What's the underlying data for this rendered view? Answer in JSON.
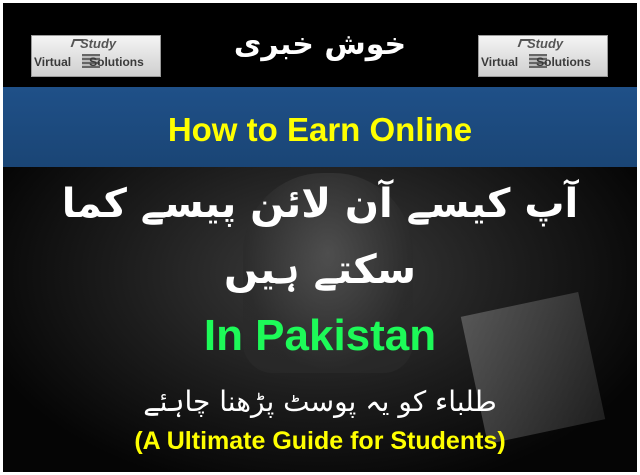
{
  "header": {
    "title_urdu": "خوش خبری",
    "logo_left": {
      "top": "Study",
      "left": "Virtual",
      "right": "Solutions"
    },
    "logo_right": {
      "top": "Study",
      "left": "Virtual",
      "right": "Solutions"
    }
  },
  "banner": {
    "headline": "How to Earn Online"
  },
  "body": {
    "urdu_line1": "آپ کیسے آن لائن پیسے کما",
    "urdu_line2": "سکتے ہیں",
    "country": "In Pakistan",
    "urdu_line3": "طلباء کو یہ پوسٹ پڑھنا چاہئے",
    "guide": "(A Ultimate Guide for Students)"
  },
  "colors": {
    "background": "#000000",
    "banner": "#1f4e79",
    "headline": "#ffff00",
    "country": "#1dfa58",
    "text": "#ffffff"
  }
}
